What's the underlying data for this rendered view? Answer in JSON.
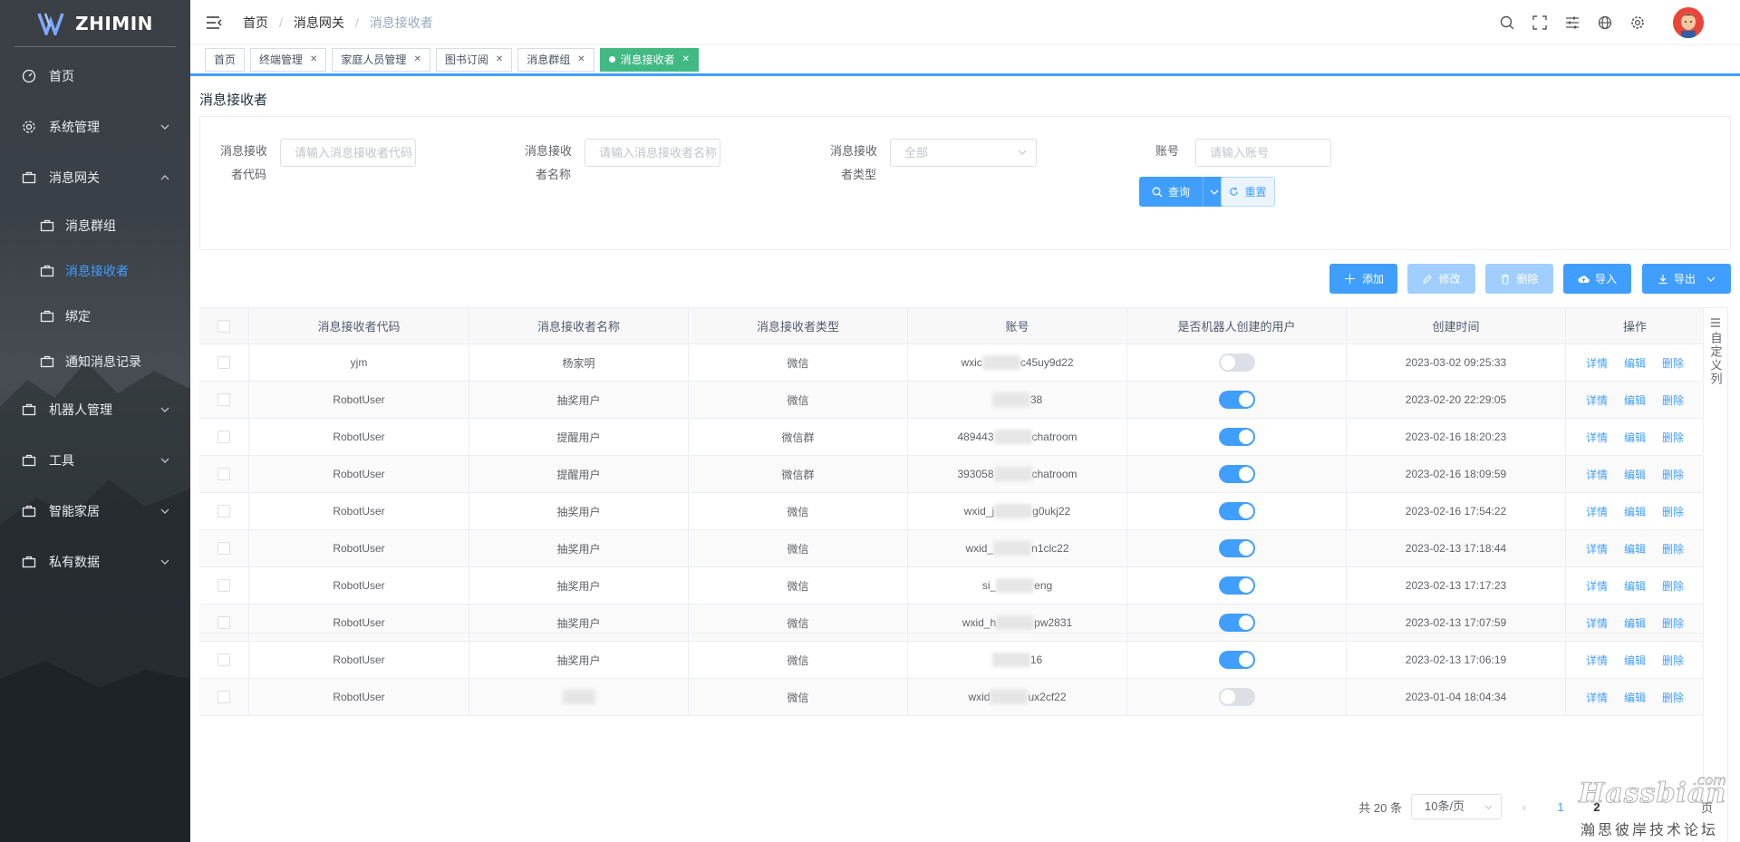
{
  "app": {
    "logo_text": "ZHIMIN"
  },
  "sidebar": {
    "items": [
      {
        "label": "首页",
        "icon": "dashboard-icon"
      },
      {
        "label": "系统管理",
        "icon": "gear-icon"
      },
      {
        "label": "消息网关",
        "icon": "briefcase-icon",
        "expanded": true,
        "children": [
          {
            "label": "消息群组"
          },
          {
            "label": "消息接收者",
            "active": true
          },
          {
            "label": "绑定"
          },
          {
            "label": "通知消息记录"
          }
        ]
      },
      {
        "label": "机器人管理",
        "icon": "briefcase-icon"
      },
      {
        "label": "工具",
        "icon": "briefcase-icon"
      },
      {
        "label": "智能家居",
        "icon": "briefcase-icon"
      },
      {
        "label": "私有数据",
        "icon": "briefcase-icon"
      }
    ]
  },
  "header": {
    "breadcrumb": [
      "首页",
      "消息网关",
      "消息接收者"
    ]
  },
  "tags": [
    {
      "label": "首页",
      "closable": false
    },
    {
      "label": "终端管理",
      "closable": true
    },
    {
      "label": "家庭人员管理",
      "closable": true
    },
    {
      "label": "图书订阅",
      "closable": true
    },
    {
      "label": "消息群组",
      "closable": true
    },
    {
      "label": "消息接收者",
      "closable": true,
      "active": true
    }
  ],
  "page": {
    "title": "消息接收者",
    "form": {
      "code_label_1": "消息接收",
      "code_label_2": "者代码",
      "code_placeholder": "请输入消息接收者代码",
      "name_label_1": "消息接收",
      "name_label_2": "者名称",
      "name_placeholder": "请输入消息接收者名称",
      "type_label_1": "消息接收",
      "type_label_2": "者类型",
      "type_value": "全部",
      "account_label": "账号",
      "account_placeholder": "请输入账号",
      "query_button": "查询",
      "reset_button": "重置"
    },
    "toolbar": {
      "add": "添加",
      "edit": "修改",
      "delete": "删除",
      "import": "导入",
      "export": "导出"
    },
    "table": {
      "columns": [
        "消息接收者代码",
        "消息接收者名称",
        "消息接收者类型",
        "账号",
        "是否机器人创建的用户",
        "创建时间",
        "操作"
      ],
      "row_actions": [
        "详情",
        "编辑",
        "删除"
      ],
      "rows": [
        {
          "code": "yjm",
          "name": "杨家明",
          "type": "微信",
          "acct_prefix": "wxic",
          "acct_suffix": "c45uy9d22",
          "robot": false,
          "created": "2023-03-02 09:25:33"
        },
        {
          "code": "RobotUser",
          "name": "抽奖用户",
          "type": "微信",
          "acct_prefix": "",
          "acct_suffix": "38",
          "robot": true,
          "created": "2023-02-20 22:29:05"
        },
        {
          "code": "RobotUser",
          "name": "提醒用户",
          "type": "微信群",
          "acct_prefix": "489443",
          "acct_suffix": "chatroom",
          "robot": true,
          "created": "2023-02-16 18:20:23"
        },
        {
          "code": "RobotUser",
          "name": "提醒用户",
          "type": "微信群",
          "acct_prefix": "393058",
          "acct_suffix": "chatroom",
          "robot": true,
          "created": "2023-02-16 18:09:59"
        },
        {
          "code": "RobotUser",
          "name": "抽奖用户",
          "type": "微信",
          "acct_prefix": "wxid_j",
          "acct_suffix": "g0ukj22",
          "robot": true,
          "created": "2023-02-16 17:54:22"
        },
        {
          "code": "RobotUser",
          "name": "抽奖用户",
          "type": "微信",
          "acct_prefix": "wxid_",
          "acct_suffix": "n1clc22",
          "robot": true,
          "created": "2023-02-13 17:18:44"
        },
        {
          "code": "RobotUser",
          "name": "抽奖用户",
          "type": "微信",
          "acct_prefix": "si_",
          "acct_suffix": "eng",
          "robot": true,
          "created": "2023-02-13 17:17:23"
        },
        {
          "code": "RobotUser",
          "name": "抽奖用户",
          "type": "微信",
          "acct_prefix": "wxid_h",
          "acct_suffix": "pw2831",
          "robot": true,
          "created": "2023-02-13 17:07:59"
        },
        {
          "code": "RobotUser",
          "name": "抽奖用户",
          "type": "微信",
          "acct_prefix": "",
          "acct_suffix": "16",
          "robot": true,
          "created": "2023-02-13 17:06:19"
        },
        {
          "code": "RobotUser",
          "name": "",
          "type": "微信",
          "acct_prefix": "wxid",
          "acct_suffix": "ux2cf22",
          "robot": false,
          "created": "2023-01-04 18:04:34"
        }
      ]
    },
    "custom_columns_label": "自定义列",
    "pagination": {
      "total": "共 20 条",
      "page_size": "10条/页",
      "pages": [
        "1",
        "2"
      ],
      "current": "1",
      "page_suffix": "页"
    }
  },
  "watermark": {
    "big": "Hassbian",
    "com": ".com",
    "small": "瀚思彼岸技术论坛"
  },
  "colors": {
    "primary": "#409eff",
    "active_tag": "#42b983"
  }
}
